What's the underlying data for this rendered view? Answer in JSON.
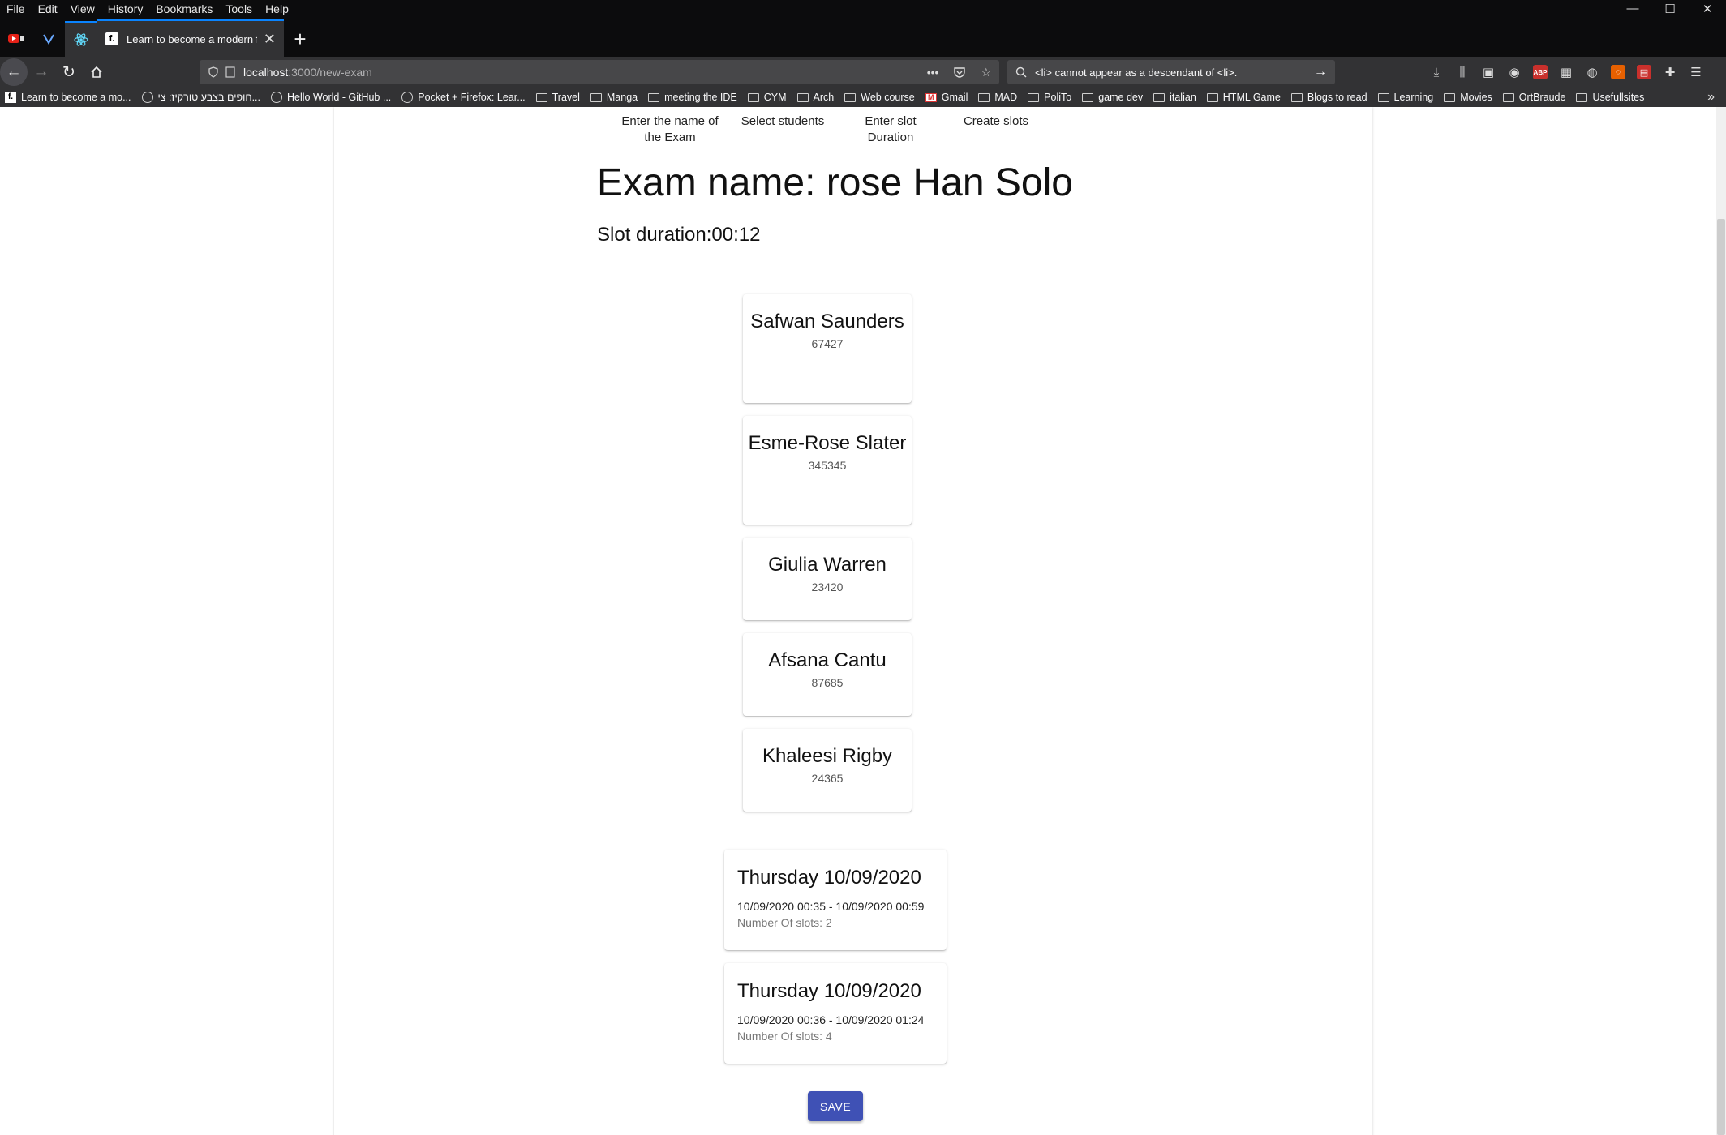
{
  "menubar": {
    "items": [
      "File",
      "Edit",
      "View",
      "History",
      "Bookmarks",
      "Tools",
      "Help"
    ]
  },
  "window_controls": {
    "minimize": "—",
    "maximize": "☐",
    "close": "✕"
  },
  "tabs": {
    "active_title": "Learn to become a modern fro",
    "new_tab": "+"
  },
  "urlbar": {
    "host": "localhost",
    "path": ":3000/new-exam",
    "more": "•••"
  },
  "searchbar": {
    "text": "<li> cannot appear as a descendant of <li>."
  },
  "bookmarks": [
    {
      "label": "Learn to become a mo...",
      "type": "fav"
    },
    {
      "label": "חופים בצבע טורקיז: צי...",
      "type": "globe"
    },
    {
      "label": "Hello World - GitHub ...",
      "type": "globe"
    },
    {
      "label": "Pocket + Firefox: Lear...",
      "type": "globe"
    },
    {
      "label": "Travel",
      "type": "folder"
    },
    {
      "label": "Manga",
      "type": "folder"
    },
    {
      "label": "meeting the IDE",
      "type": "folder"
    },
    {
      "label": "CYM",
      "type": "folder"
    },
    {
      "label": "Arch",
      "type": "folder"
    },
    {
      "label": "Web course",
      "type": "folder"
    },
    {
      "label": "Gmail",
      "type": "gmail"
    },
    {
      "label": "MAD",
      "type": "folder"
    },
    {
      "label": "PoliTo",
      "type": "folder"
    },
    {
      "label": "game dev",
      "type": "folder"
    },
    {
      "label": "italian",
      "type": "folder"
    },
    {
      "label": "HTML Game",
      "type": "folder"
    },
    {
      "label": "Blogs to read",
      "type": "folder"
    },
    {
      "label": "Learning",
      "type": "folder"
    },
    {
      "label": "Movies",
      "type": "folder"
    },
    {
      "label": "OrtBraude",
      "type": "folder"
    },
    {
      "label": "Usefullsites",
      "type": "folder"
    }
  ],
  "steps": {
    "step1": "Enter the name of the Exam",
    "step2": "Select students",
    "step3": "Enter slot Duration",
    "step4": "Create slots"
  },
  "exam": {
    "title": "Exam name: rose Han Solo",
    "slot_duration": "Slot duration:00:12"
  },
  "students": [
    {
      "name": "Safwan Saunders",
      "id": "67427"
    },
    {
      "name": "Esme-Rose Slater",
      "id": "345345"
    },
    {
      "name": "Giulia Warren",
      "id": "23420"
    },
    {
      "name": "Afsana Cantu",
      "id": "87685"
    },
    {
      "name": "Khaleesi Rigby",
      "id": "24365"
    }
  ],
  "slots": [
    {
      "day": "Thursday 10/09/2020",
      "range": "10/09/2020 00:35 - 10/09/2020 00:59",
      "count": "Number Of slots: 2"
    },
    {
      "day": "Thursday 10/09/2020",
      "range": "10/09/2020 00:36 - 10/09/2020 01:24",
      "count": "Number Of slots: 4"
    }
  ],
  "actions": {
    "save_label": "SAVE"
  },
  "colors": {
    "primary": "#3f51b5",
    "browser_dark": "#0c0c0d",
    "toolbar": "#323234"
  }
}
